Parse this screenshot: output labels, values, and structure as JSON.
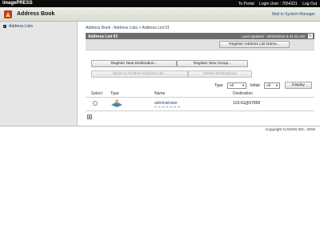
{
  "topbar": {
    "brand": "imagePRESS",
    "to_portal": "To Portal",
    "login_user": "Login User : 7654321",
    "logout": "Log Out"
  },
  "header": {
    "title": "Address Book",
    "system_manager": "Mail to System Manager"
  },
  "sidebar": {
    "items": [
      {
        "label": "Address Lists"
      }
    ]
  },
  "breadcrumb": {
    "root": "Address Book",
    "sep1": " : ",
    "parent": "Address Lists",
    "sep2": " > ",
    "current": "Address List 01"
  },
  "panel": {
    "title": "Address List 01",
    "last_updated": "Last Updated : 09/25/2015 6:41:22 AM",
    "refresh_icon": "refresh-icon",
    "register_name_button": "Register Address List Name..."
  },
  "actions": {
    "register_destination": "Register New Destination...",
    "register_group": "Register New Group...",
    "move_to_list": "Move to Another Address List...",
    "delete_destinations": "Delete Destinations"
  },
  "filters": {
    "type_label": "Type",
    "type_value": "All",
    "initial_label": "Initial",
    "initial_value": "All",
    "display_button": "Display"
  },
  "table": {
    "columns": [
      "Select",
      "Type",
      "Name",
      "Destination"
    ],
    "rows": [
      {
        "selected": false,
        "type_icon": "user-icon",
        "name": "administrator",
        "destination": "123-IG@67890"
      }
    ]
  },
  "footer": {
    "copyright": "Copyright CANON INC. 2015"
  }
}
